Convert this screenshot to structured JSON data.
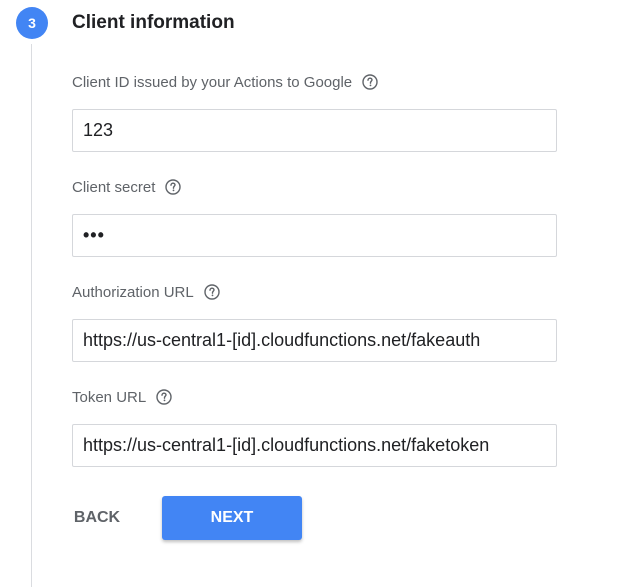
{
  "step": {
    "number": "3",
    "title": "Client information"
  },
  "fields": {
    "client_id": {
      "label": "Client ID issued by your Actions to Google",
      "value": "123"
    },
    "client_secret": {
      "label": "Client secret",
      "value": "•••"
    },
    "authorization_url": {
      "label": "Authorization URL",
      "value": "https://us-central1-[id].cloudfunctions.net/fakeauth"
    },
    "token_url": {
      "label": "Token URL",
      "value": "https://us-central1-[id].cloudfunctions.net/faketoken"
    }
  },
  "buttons": {
    "back_label": "BACK",
    "next_label": "NEXT"
  },
  "colors": {
    "accent": "#4285f4",
    "label_text": "#5f6368",
    "border": "#d5d7db"
  },
  "icons": {
    "help": "help-circle-outline-icon"
  }
}
